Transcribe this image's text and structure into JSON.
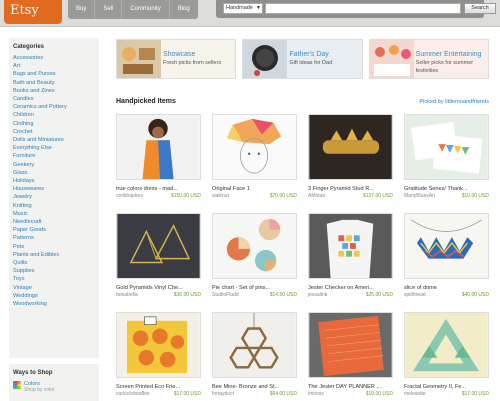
{
  "header": {
    "logo": "Etsy",
    "nav": [
      "Buy",
      "Sell",
      "Community",
      "Blog"
    ],
    "search_select": "Handmade",
    "search_button": "Search",
    "search_value": ""
  },
  "sidebar": {
    "categories_title": "Categories",
    "categories": [
      "Accessories",
      "Art",
      "Bags and Purses",
      "Bath and Beauty",
      "Books and Zines",
      "Candles",
      "Ceramics and Pottery",
      "Children",
      "Clothing",
      "Crochet",
      "Dolls and Miniatures",
      "Everything Else",
      "Furniture",
      "Geekery",
      "Glass",
      "Holidays",
      "Housewares",
      "Jewelry",
      "Knitting",
      "Music",
      "Needlecraft",
      "Paper Goods",
      "Patterns",
      "Pets",
      "Plants and Edibles",
      "Quilts",
      "Supplies",
      "Toys",
      "Vintage",
      "Weddings",
      "Woodworking"
    ],
    "ways_title": "Ways to Shop",
    "ways_colors": "Colors",
    "ways_colors_sub": "Shop by color"
  },
  "banners": [
    {
      "title": "Showcase",
      "sub": "Fresh picks from sellers"
    },
    {
      "title": "Father's Day",
      "sub": "Gift ideas for Dad"
    },
    {
      "title": "Summer Entertaining",
      "sub": "Seller picks for summer festivities"
    }
  ],
  "handpicked": {
    "title": "Handpicked Items",
    "by": "Picked by littlemoandfriends",
    "items": [
      {
        "title": "true colors dress - mad...",
        "shop": "cmlldraplres",
        "price": "$150.00 USD",
        "icon": "dress-photo"
      },
      {
        "title": "Original Face 1",
        "shop": "walknut",
        "price": "$70.00 USD",
        "icon": "face-drawing"
      },
      {
        "title": "3 Finger Pyramid Stud R...",
        "shop": "AMotan",
        "price": "$127.00 USD",
        "icon": "ring-photo"
      },
      {
        "title": "Gratitude Series/ Thank...",
        "shop": "ManyBluesArt",
        "price": "$10.00 USD",
        "icon": "bunting-cards"
      },
      {
        "title": "Gold Pyramids Vinyl Che...",
        "shop": "bebabella",
        "price": "$36.00 USD",
        "icon": "gold-pyramids"
      },
      {
        "title": "Pie chart - Set of pins...",
        "shop": "StudioFludd",
        "price": "$14.50 USD",
        "icon": "pie-pins"
      },
      {
        "title": "Jester Checker on Ameri...",
        "shop": "jessalinb",
        "price": "$25.00 USD",
        "icon": "checker-shirt"
      },
      {
        "title": "slice of dome",
        "shop": "spiithread",
        "price": "$40.00 USD",
        "icon": "zigzag-necklace"
      },
      {
        "title": "Screen Printed Eco Frie...",
        "shop": "curlockdoodles",
        "price": "$17.00 USD",
        "icon": "orange-print"
      },
      {
        "title": "Bee Mine- Bronze and St...",
        "shop": "fortayduct",
        "price": "$64.00 USD",
        "icon": "honeycomb-necklace"
      },
      {
        "title": "The Jester DAY PLANNER ...",
        "shop": "lmooss",
        "price": "$19.00 USD",
        "icon": "planner"
      },
      {
        "title": "Fractal Geometry II, Fe...",
        "shop": "melosette",
        "price": "$17.00 USD",
        "icon": "fractal-quilt"
      }
    ]
  }
}
